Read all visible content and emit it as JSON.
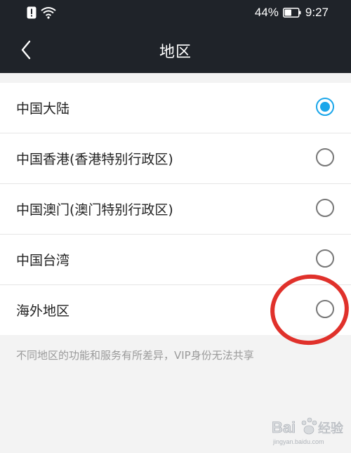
{
  "status_bar": {
    "battery_percent": "44%",
    "time": "9:27",
    "icons": [
      "alert-icon",
      "wifi-icon",
      "battery-icon"
    ]
  },
  "header": {
    "title": "地区",
    "back_icon": "chevron-left-icon"
  },
  "regions": [
    {
      "label": "中国大陆",
      "selected": true
    },
    {
      "label": "中国香港(香港特别行政区)",
      "selected": false
    },
    {
      "label": "中国澳门(澳门特别行政区)",
      "selected": false
    },
    {
      "label": "中国台湾",
      "selected": false
    },
    {
      "label": "海外地区",
      "selected": false
    }
  ],
  "footnote": "不同地区的功能和服务有所差异，VIP身份无法共享",
  "watermark": {
    "text": "Bai 经验",
    "subtext": "jingyan.baidu.com"
  },
  "colors": {
    "header_bg": "#1f2329",
    "accent": "#1aa6ea",
    "annotation": "#e0312b",
    "page_bg": "#f3f3f3"
  }
}
